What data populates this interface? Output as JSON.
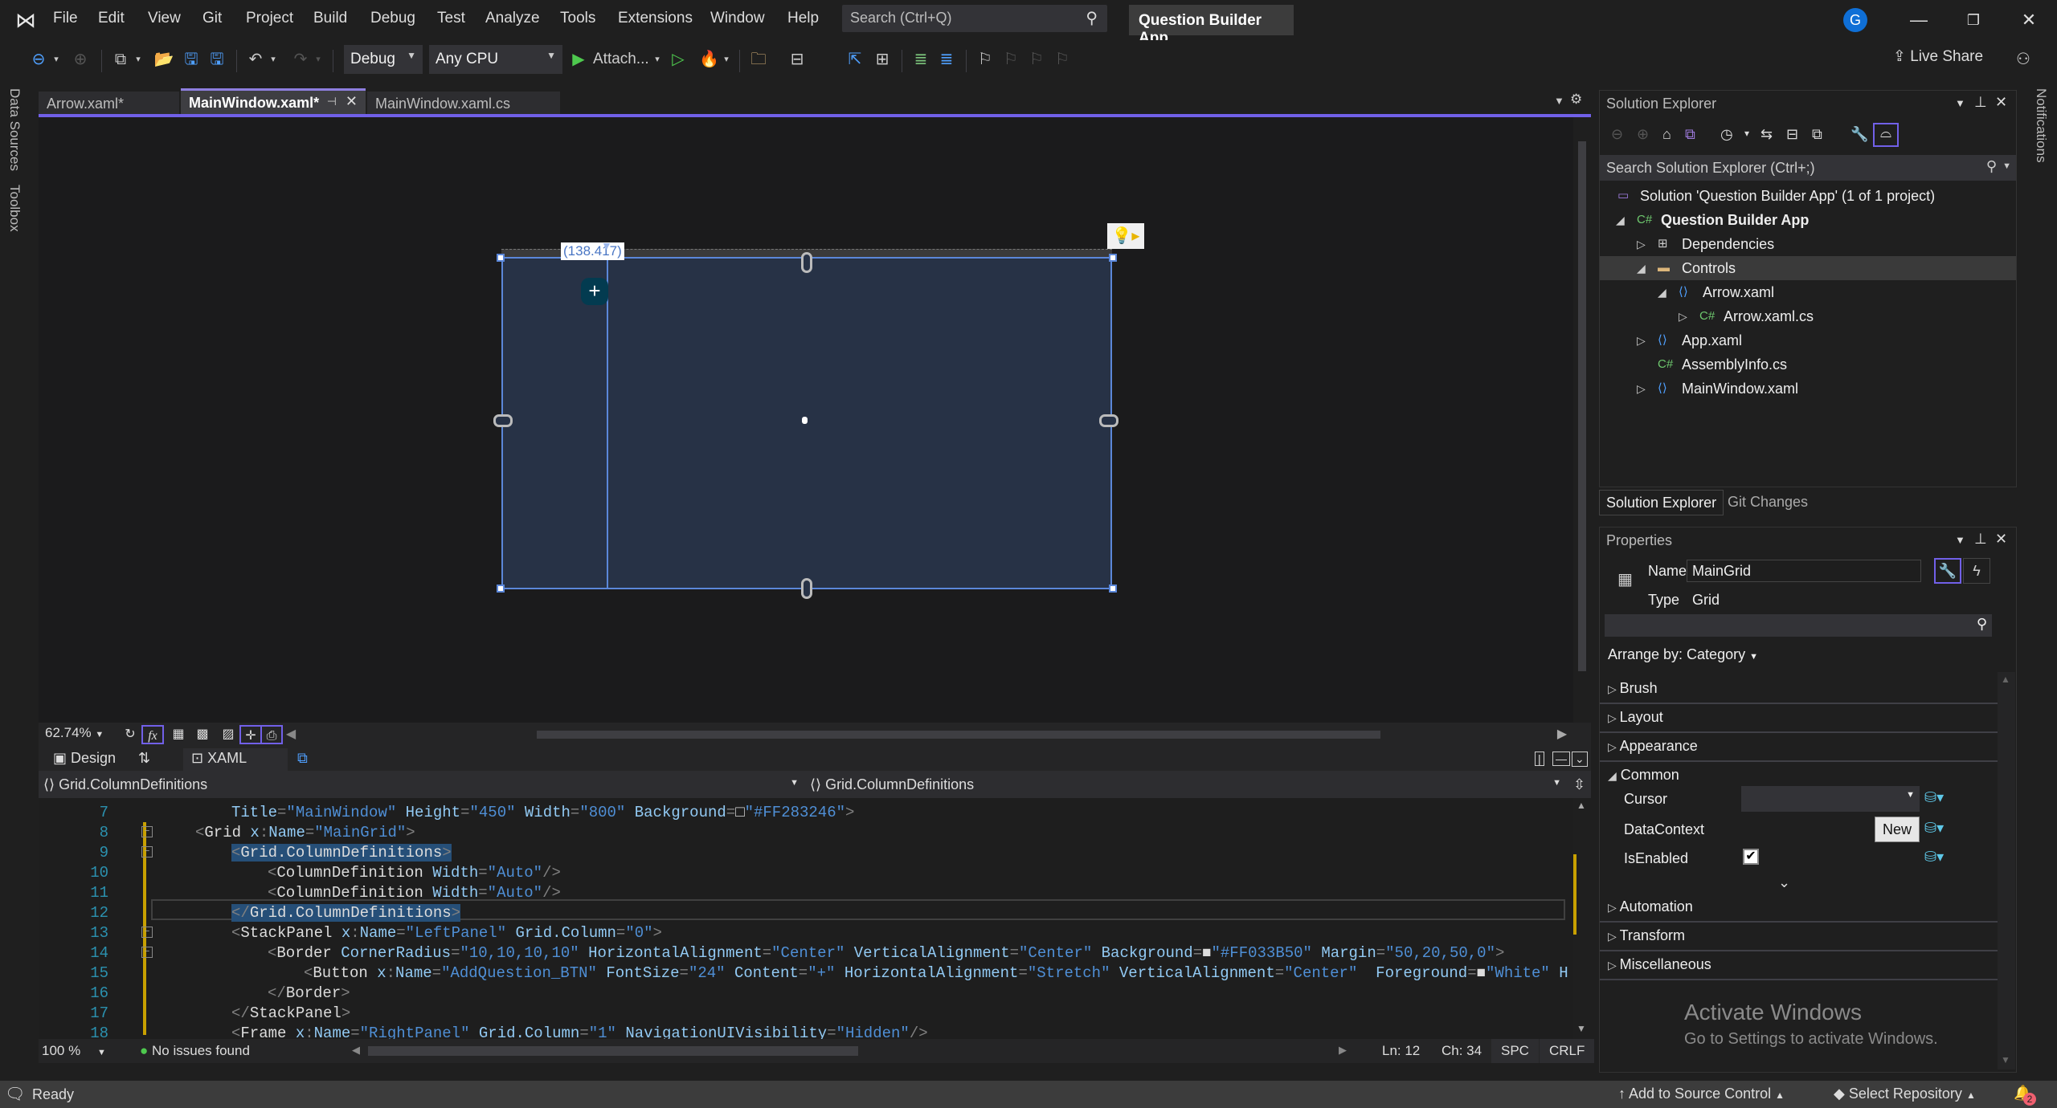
{
  "titlebar": {
    "menu": [
      "File",
      "Edit",
      "View",
      "Git",
      "Project",
      "Build",
      "Debug",
      "Test",
      "Analyze",
      "Tools",
      "Extensions",
      "Window",
      "Help"
    ],
    "search_placeholder": "Search (Ctrl+Q)",
    "project_name": "Question Builder App",
    "avatar_initial": "G"
  },
  "toolbar": {
    "configuration": "Debug",
    "platform": "Any CPU",
    "attach_label": "Attach...",
    "live_share": "Live Share"
  },
  "left_rail": {
    "tabs": [
      "Data Sources",
      "Toolbox"
    ]
  },
  "right_rail": {
    "tabs": [
      "Notifications"
    ]
  },
  "doc_tabs": [
    {
      "label": "Arrow.xaml*",
      "active": false
    },
    {
      "label": "MainWindow.xaml*",
      "active": true
    },
    {
      "label": "MainWindow.xaml.cs",
      "active": false
    }
  ],
  "designer": {
    "coordinate_tip": "(138.417)",
    "add_button_glyph": "+",
    "zoom_level": "62.74%",
    "design_tab": "Design",
    "xaml_tab": "XAML"
  },
  "breadcrumbs": {
    "left": "Grid.ColumnDefinitions",
    "right": "Grid.ColumnDefinitions"
  },
  "code": {
    "lines": [
      {
        "n": "7",
        "indent": 1,
        "html": "<span class='c-attr'>Title</span><span class='c-pun'>=</span><span class='c-str'>\"MainWindow\"</span> <span class='c-attr'>Height</span><span class='c-pun'>=</span><span class='c-str'>\"450\"</span> <span class='c-attr'>Width</span><span class='c-pun'>=</span><span class='c-str'>\"800\"</span> <span class='c-attr'>Background</span><span class='c-pun'>=</span>□<span class='c-str'>\"#FF283246\"</span><span class='c-pun'>&gt;</span>"
      },
      {
        "n": "8",
        "indent": 0,
        "html": "<span class='c-pun'>&lt;</span><span class='c-el'>Grid</span> <span class='c-attr'>x</span><span class='c-pun'>:</span><span class='c-attr'>Name</span><span class='c-pun'>=</span><span class='c-str'>\"MainGrid\"</span><span class='c-pun'>&gt;</span>"
      },
      {
        "n": "9",
        "indent": 1,
        "html": "<span class='hl'><span class='c-pun'>&lt;</span><span class='c-el'>Grid.ColumnDefinitions</span><span class='c-pun'>&gt;</span></span>"
      },
      {
        "n": "10",
        "indent": 2,
        "html": "<span class='c-pun'>&lt;</span><span class='c-el'>ColumnDefinition</span> <span class='c-attr'>Width</span><span class='c-pun'>=</span><span class='c-str'>\"Auto\"</span><span class='c-pun'>/&gt;</span>"
      },
      {
        "n": "11",
        "indent": 2,
        "html": "<span class='c-pun'>&lt;</span><span class='c-el'>ColumnDefinition</span> <span class='c-attr'>Width</span><span class='c-pun'>=</span><span class='c-str'>\"Auto\"</span><span class='c-pun'>/&gt;</span>"
      },
      {
        "n": "12",
        "indent": 1,
        "html": "<span class='hl'><span class='c-pun'>&lt;/</span><span class='c-el'>Grid.ColumnDefinitions</span><span class='c-pun'>&gt;</span></span>"
      },
      {
        "n": "13",
        "indent": 1,
        "html": "<span class='c-pun'>&lt;</span><span class='c-el'>StackPanel</span> <span class='c-attr'>x</span><span class='c-pun'>:</span><span class='c-attr'>Name</span><span class='c-pun'>=</span><span class='c-str'>\"LeftPanel\"</span> <span class='c-attr'>Grid.Column</span><span class='c-pun'>=</span><span class='c-str'>\"0\"</span><span class='c-pun'>&gt;</span>"
      },
      {
        "n": "14",
        "indent": 2,
        "html": "<span class='c-pun'>&lt;</span><span class='c-el'>Border</span> <span class='c-attr'>CornerRadius</span><span class='c-pun'>=</span><span class='c-str'>\"10,10,10,10\"</span> <span class='c-attr'>HorizontalAlignment</span><span class='c-pun'>=</span><span class='c-str'>\"Center\"</span> <span class='c-attr'>VerticalAlignment</span><span class='c-pun'>=</span><span class='c-str'>\"Center\"</span> <span class='c-attr'>Background</span><span class='c-pun'>=</span>■<span class='c-str'>\"#FF033B50\"</span> <span class='c-attr'>Margin</span><span class='c-pun'>=</span><span class='c-str'>\"50,20,50,0\"</span><span class='c-pun'>&gt;</span>"
      },
      {
        "n": "15",
        "indent": 3,
        "html": "<span class='c-pun'>&lt;</span><span class='c-el'>Button</span> <span class='c-attr'>x</span><span class='c-pun'>:</span><span class='c-attr'>Name</span><span class='c-pun'>=</span><span class='c-str'>\"AddQuestion_BTN\"</span> <span class='c-attr'>FontSize</span><span class='c-pun'>=</span><span class='c-str'>\"24\"</span> <span class='c-attr'>Content</span><span class='c-pun'>=</span><span class='c-str'>\"+\"</span> <span class='c-attr'>HorizontalAlignment</span><span class='c-pun'>=</span><span class='c-str'>\"Stretch\"</span> <span class='c-attr'>VerticalAlignment</span><span class='c-pun'>=</span><span class='c-str'>\"Center\"</span>  <span class='c-attr'>Foreground</span><span class='c-pun'>=</span>■<span class='c-str'>\"White\"</span> <span class='c-attr'>H</span>"
      },
      {
        "n": "16",
        "indent": 2,
        "html": "<span class='c-pun'>&lt;/</span><span class='c-el'>Border</span><span class='c-pun'>&gt;</span>"
      },
      {
        "n": "17",
        "indent": 1,
        "html": "<span class='c-pun'>&lt;/</span><span class='c-el'>StackPanel</span><span class='c-pun'>&gt;</span>"
      },
      {
        "n": "18",
        "indent": 1,
        "html": "<span class='c-pun'>&lt;</span><span class='c-el'>Frame</span> <span class='c-attr'>x</span><span class='c-pun'>:</span><span class='c-attr'>Name</span><span class='c-pun'>=</span><span class='c-str'>\"RightPanel\"</span> <span class='c-attr'>Grid.Column</span><span class='c-pun'>=</span><span class='c-str'>\"1\"</span> <span class='c-attr'>NavigationUIVisibility</span><span class='c-pun'>=</span><span class='c-str'>\"Hidden\"</span><span class='c-pun'>/&gt;</span>"
      }
    ]
  },
  "editor_status": {
    "zoom": "100 %",
    "issues": "No issues found",
    "line": "Ln: 12",
    "col": "Ch: 34",
    "whitespace": "SPC",
    "line_ending": "CRLF"
  },
  "solution_explorer": {
    "title": "Solution Explorer",
    "search_placeholder": "Search Solution Explorer (Ctrl+;)",
    "tree": [
      {
        "label": "Solution 'Question Builder App' (1 of 1 project)",
        "level": 0,
        "expander": "",
        "icon": "solution-icon",
        "bold": false,
        "selected": false
      },
      {
        "label": "Question Builder App",
        "level": 0,
        "expander": "◢",
        "icon": "csharp-project-icon",
        "bold": true,
        "selected": false
      },
      {
        "label": "Dependencies",
        "level": 1,
        "expander": "▷",
        "icon": "dependencies-icon",
        "bold": false,
        "selected": false
      },
      {
        "label": "Controls",
        "level": 1,
        "expander": "◢",
        "icon": "folder-icon",
        "bold": false,
        "selected": true
      },
      {
        "label": "Arrow.xaml",
        "level": 2,
        "expander": "◢",
        "icon": "xaml-file-icon",
        "bold": false,
        "selected": false
      },
      {
        "label": "Arrow.xaml.cs",
        "level": 3,
        "expander": "▷",
        "icon": "csharp-file-icon",
        "bold": false,
        "selected": false
      },
      {
        "label": "App.xaml",
        "level": 1,
        "expander": "▷",
        "icon": "xaml-file-icon",
        "bold": false,
        "selected": false
      },
      {
        "label": "AssemblyInfo.cs",
        "level": 1,
        "expander": "",
        "icon": "csharp-file-icon",
        "bold": false,
        "selected": false
      },
      {
        "label": "MainWindow.xaml",
        "level": 1,
        "expander": "▷",
        "icon": "xaml-file-icon",
        "bold": false,
        "selected": false
      }
    ],
    "bottom_tabs": [
      "Solution Explorer",
      "Git Changes"
    ]
  },
  "properties": {
    "title": "Properties",
    "name_label": "Name",
    "name_value": "MainGrid",
    "type_label": "Type",
    "type_value": "Grid",
    "arrange_by": "Arrange by: Category",
    "categories_top": [
      "Brush",
      "Layout",
      "Appearance"
    ],
    "common": {
      "label": "Common",
      "cursor_label": "Cursor",
      "datacontext_label": "DataContext",
      "datacontext_button": "New",
      "isenabled_label": "IsEnabled",
      "isenabled_checked": true
    },
    "categories_bottom": [
      "Automation",
      "Transform",
      "Miscellaneous"
    ]
  },
  "watermark": {
    "title": "Activate Windows",
    "subtitle": "Go to Settings to activate Windows."
  },
  "statusbar": {
    "ready": "Ready",
    "source_control": "Add to Source Control",
    "repository": "Select Repository",
    "notification_count": "2"
  },
  "colors": {
    "accent": "#7160e8",
    "selection_blue": "#5b87d9",
    "artboard_bg": "#283246",
    "button_bg": "#033b50"
  }
}
